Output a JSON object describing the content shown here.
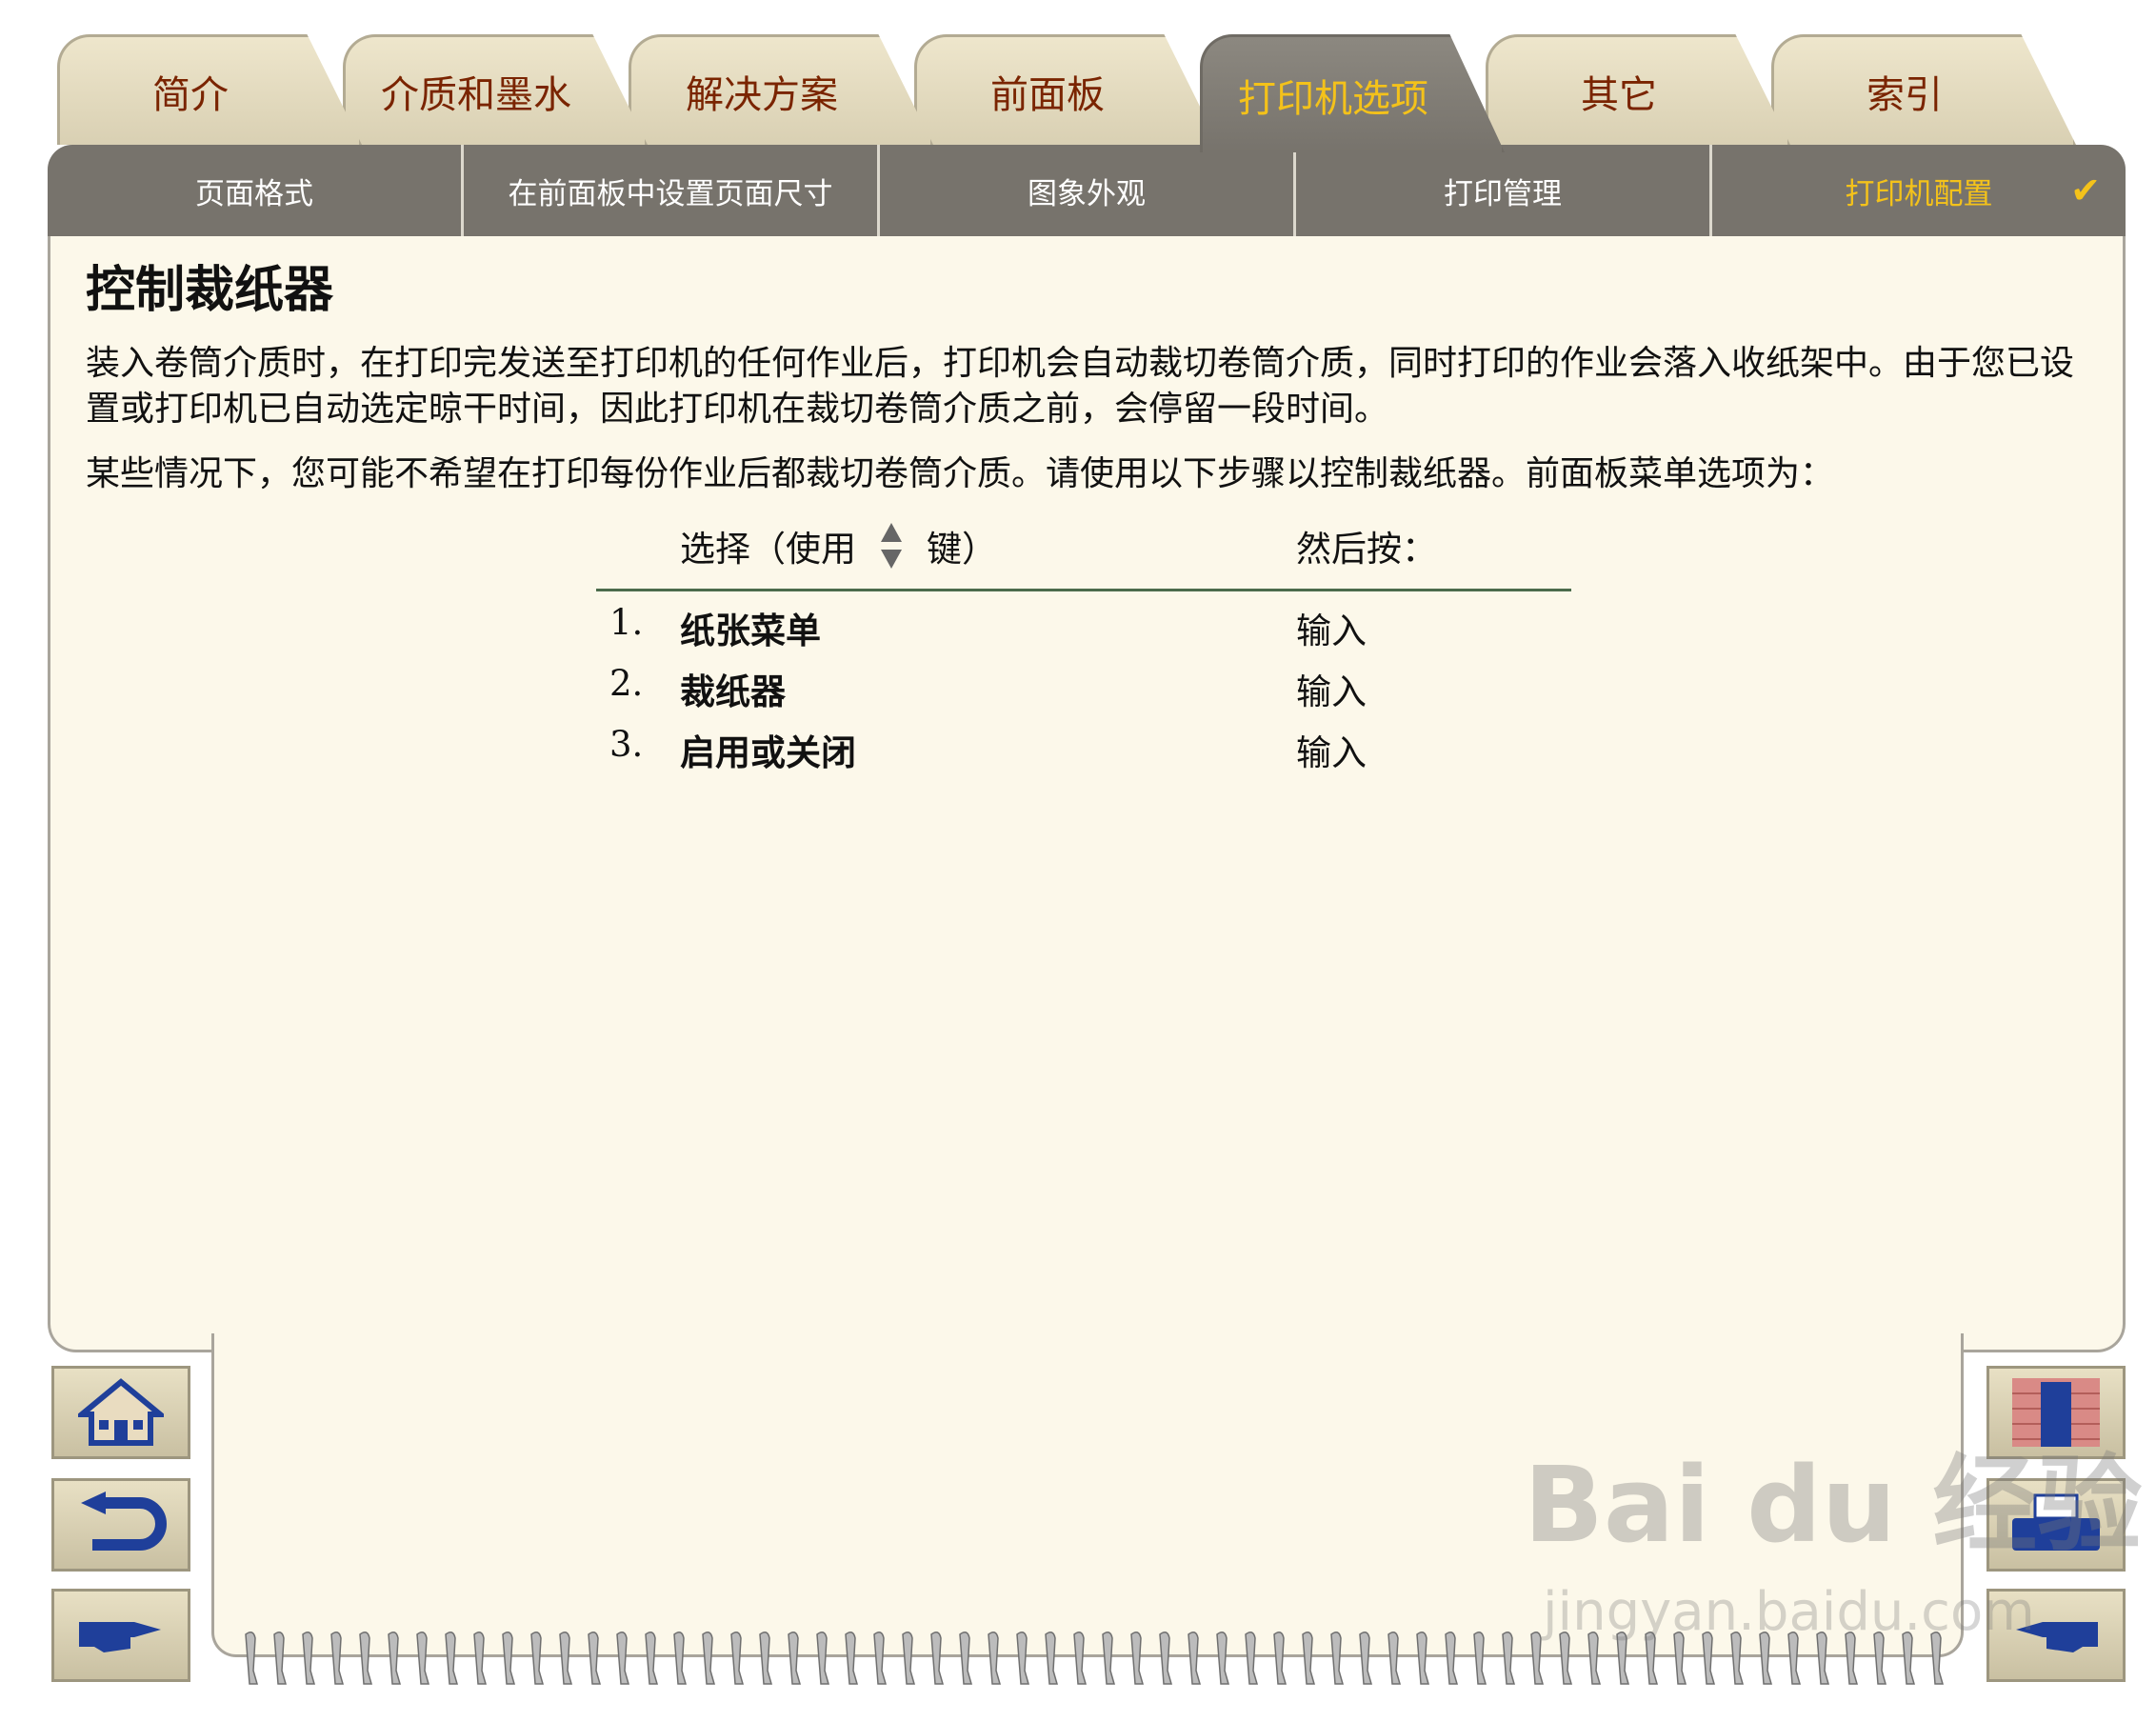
{
  "tabs": [
    {
      "label": "简介"
    },
    {
      "label": "介质和墨水"
    },
    {
      "label": "解决方案"
    },
    {
      "label": "前面板"
    },
    {
      "label": "打印机选项"
    },
    {
      "label": "其它"
    },
    {
      "label": "索引"
    }
  ],
  "active_tab": "打印机选项",
  "subnav": [
    {
      "label": "页面格式"
    },
    {
      "label": "在前面板中设置页面尺寸"
    },
    {
      "label": "图象外观"
    },
    {
      "label": "打印管理"
    },
    {
      "label": "打印机配置"
    }
  ],
  "subnav_check": "✔",
  "page": {
    "title": "控制裁纸器",
    "paragraph1": "装入卷筒介质时，在打印完发送至打印机的任何作业后，打印机会自动裁切卷筒介质，同时打印的作业会落入收纸架中。由于您已设置或打印机已自动选定晾干时间，因此打印机在裁切卷筒介质之前，会停留一段时间。",
    "paragraph2": "某些情况下，您可能不希望在打印每份作业后都裁切卷筒介质。请使用以下步骤以控制裁纸器。前面板菜单选项为："
  },
  "steps": {
    "header_select_prefix": "选择（使用",
    "header_select_suffix": "键）",
    "header_then": "然后按：",
    "rows": [
      {
        "num": "1.",
        "select": "纸张菜单",
        "then": "输入"
      },
      {
        "num": "2.",
        "select": "裁纸器",
        "then": "输入"
      },
      {
        "num": "3.",
        "select": "启用或关闭",
        "then": "输入"
      }
    ]
  },
  "nav_buttons": {
    "left": [
      "home-icon",
      "back-icon",
      "next-page-icon"
    ],
    "right": [
      "door-icon",
      "printer-icon",
      "previous-page-icon"
    ]
  },
  "watermark": {
    "main": "Bai du 经验",
    "sub": "jingyan.baidu.com"
  },
  "colors": {
    "accent_yellow": "#f4c21a",
    "tab_text": "#7a2400",
    "subnav_bg": "#77736c",
    "page_bg": "#fcf8ea"
  }
}
